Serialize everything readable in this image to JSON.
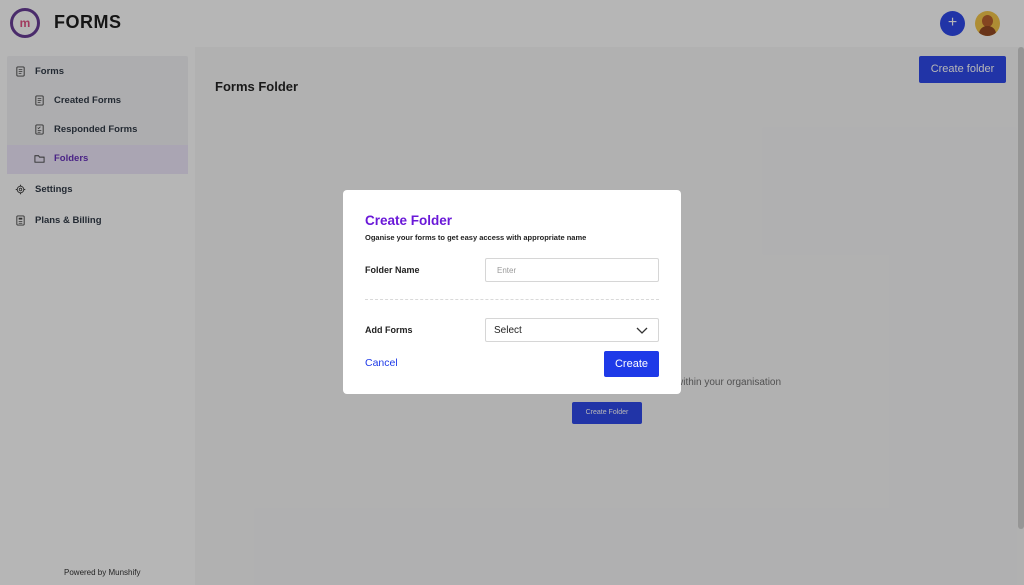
{
  "header": {
    "brand": "FORMS",
    "plus_label": "+"
  },
  "sidebar": {
    "items": [
      {
        "label": "Forms",
        "icon": "document-icon"
      },
      {
        "label": "Created Forms",
        "icon": "document-icon"
      },
      {
        "label": "Responded Forms",
        "icon": "checklist-icon"
      },
      {
        "label": "Folders",
        "icon": "folder-icon",
        "active": true
      },
      {
        "label": "Settings",
        "icon": "gear-icon"
      },
      {
        "label": "Plans & Billing",
        "icon": "billing-icon"
      }
    ],
    "footer": "Powered by Munshify"
  },
  "main": {
    "title": "Forms Folder",
    "create_folder_top": "Create folder",
    "empty_text": "within your organisation",
    "create_folder_center": "Create Folder"
  },
  "modal": {
    "title": "Create Folder",
    "subtitle": "Oganise your forms to get easy access with appropriate name",
    "folder_name_label": "Folder Name",
    "folder_name_placeholder": "Enter",
    "add_forms_label": "Add Forms",
    "add_forms_selected": "Select",
    "cancel_label": "Cancel",
    "create_label": "Create"
  },
  "colors": {
    "accent_blue": "#1e3ae8",
    "title_purple": "#6a18d8",
    "active_purple": "#5b21b6"
  }
}
